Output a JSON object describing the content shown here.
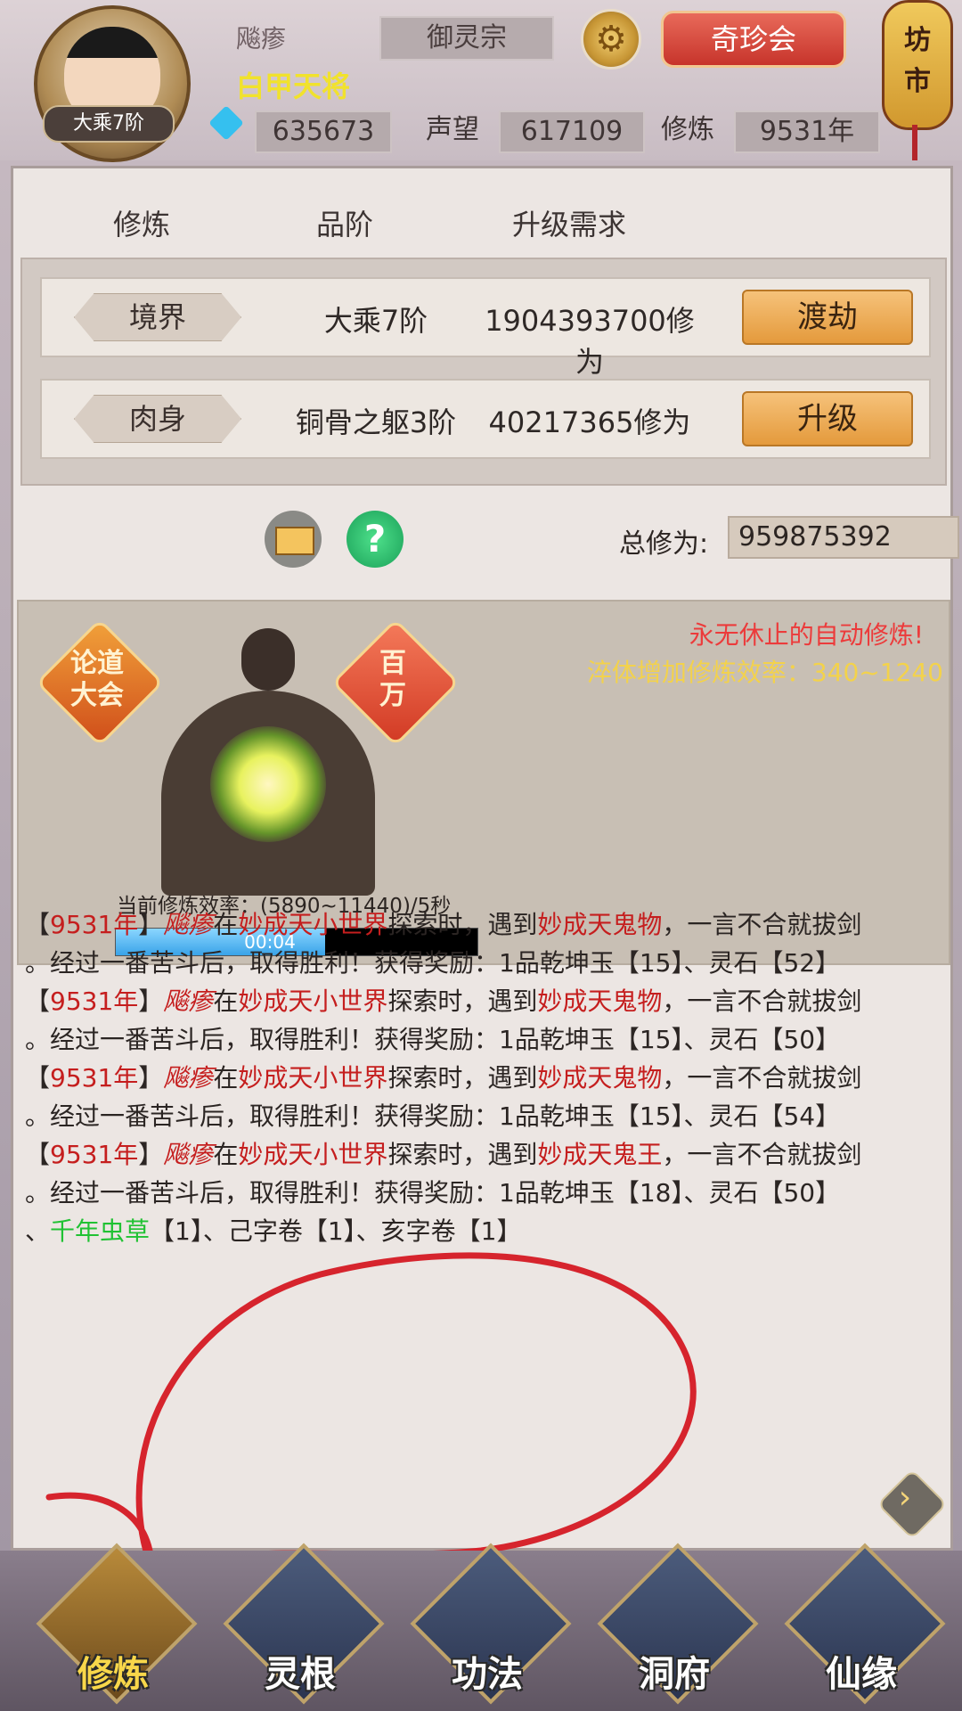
{
  "header": {
    "rank_badge": "大乘7阶",
    "player_name": "飚瘆",
    "player_title": "白甲天将",
    "sect": "御灵宗",
    "treasure_button": "奇珍会",
    "market_chars": [
      "坊",
      "市"
    ],
    "currency_value": "635673",
    "reputation_label": "声望",
    "reputation_value": "617109",
    "cultivation_label": "修炼",
    "cultivation_value": "9531年"
  },
  "panel": {
    "columns": [
      "修炼",
      "品阶",
      "升级需求"
    ],
    "rows": [
      {
        "label": "境界",
        "grade": "大乘7阶",
        "requirement": "1904393700修为",
        "button": "渡劫"
      },
      {
        "label": "肉身",
        "grade": "铜骨之躯3阶",
        "requirement": "40217365修为",
        "button": "升级"
      }
    ],
    "total_label": "总修为:",
    "total_value": "959875392"
  },
  "cultivate": {
    "slogan_red": "永无休止的自动修炼!",
    "slogan_yellow": "淬体增加修炼效率：340~1240",
    "badge_left": [
      "论道",
      "大会"
    ],
    "badge_right": [
      "百",
      "万"
    ],
    "rate_text": "当前修炼效率：(5890~11440)/5秒",
    "timer": "00:04",
    "progress_fraction": 0.58
  },
  "log": [
    {
      "year": "9531年",
      "name": "飚瘆",
      "mid1": "在",
      "world": "妙成天小世界",
      "mid2": "探索时，遇到",
      "enemy": "妙成天鬼物",
      "tail": "，一言不合就拔剑"
    },
    {
      "text": "。经过一番苦斗后，取得胜利！获得奖励：1品乾坤玉【15】、灵石【52】"
    },
    {
      "year": "9531年",
      "name": "飚瘆",
      "mid1": "在",
      "world": "妙成天小世界",
      "mid2": "探索时，遇到",
      "enemy": "妙成天鬼物",
      "tail": "，一言不合就拔剑"
    },
    {
      "text": "。经过一番苦斗后，取得胜利！获得奖励：1品乾坤玉【15】、灵石【50】"
    },
    {
      "year": "9531年",
      "name": "飚瘆",
      "mid1": "在",
      "world": "妙成天小世界",
      "mid2": "探索时，遇到",
      "enemy": "妙成天鬼物",
      "tail": "，一言不合就拔剑"
    },
    {
      "text": "。经过一番苦斗后，取得胜利！获得奖励：1品乾坤玉【15】、灵石【54】"
    },
    {
      "year": "9531年",
      "name": "飚瘆",
      "mid1": "在",
      "world": "妙成天小世界",
      "mid2": "探索时，遇到",
      "enemy": "妙成天鬼王",
      "tail": "，一言不合就拔剑"
    },
    {
      "text": "。经过一番苦斗后，取得胜利！获得奖励：1品乾坤玉【18】、灵石【50】"
    },
    {
      "pre": "、",
      "item": "千年虫草",
      "post": "【1】、己字卷【1】、亥字卷【1】"
    }
  ],
  "nav": [
    {
      "label": "修炼",
      "active": true
    },
    {
      "label": "灵根",
      "active": false
    },
    {
      "label": "功法",
      "active": false
    },
    {
      "label": "洞府",
      "active": false
    },
    {
      "label": "仙缘",
      "active": false
    }
  ],
  "colors": {
    "accent_red": "#c51e1e",
    "reward_green": "#20c233",
    "title_yellow": "#f1e22c"
  }
}
